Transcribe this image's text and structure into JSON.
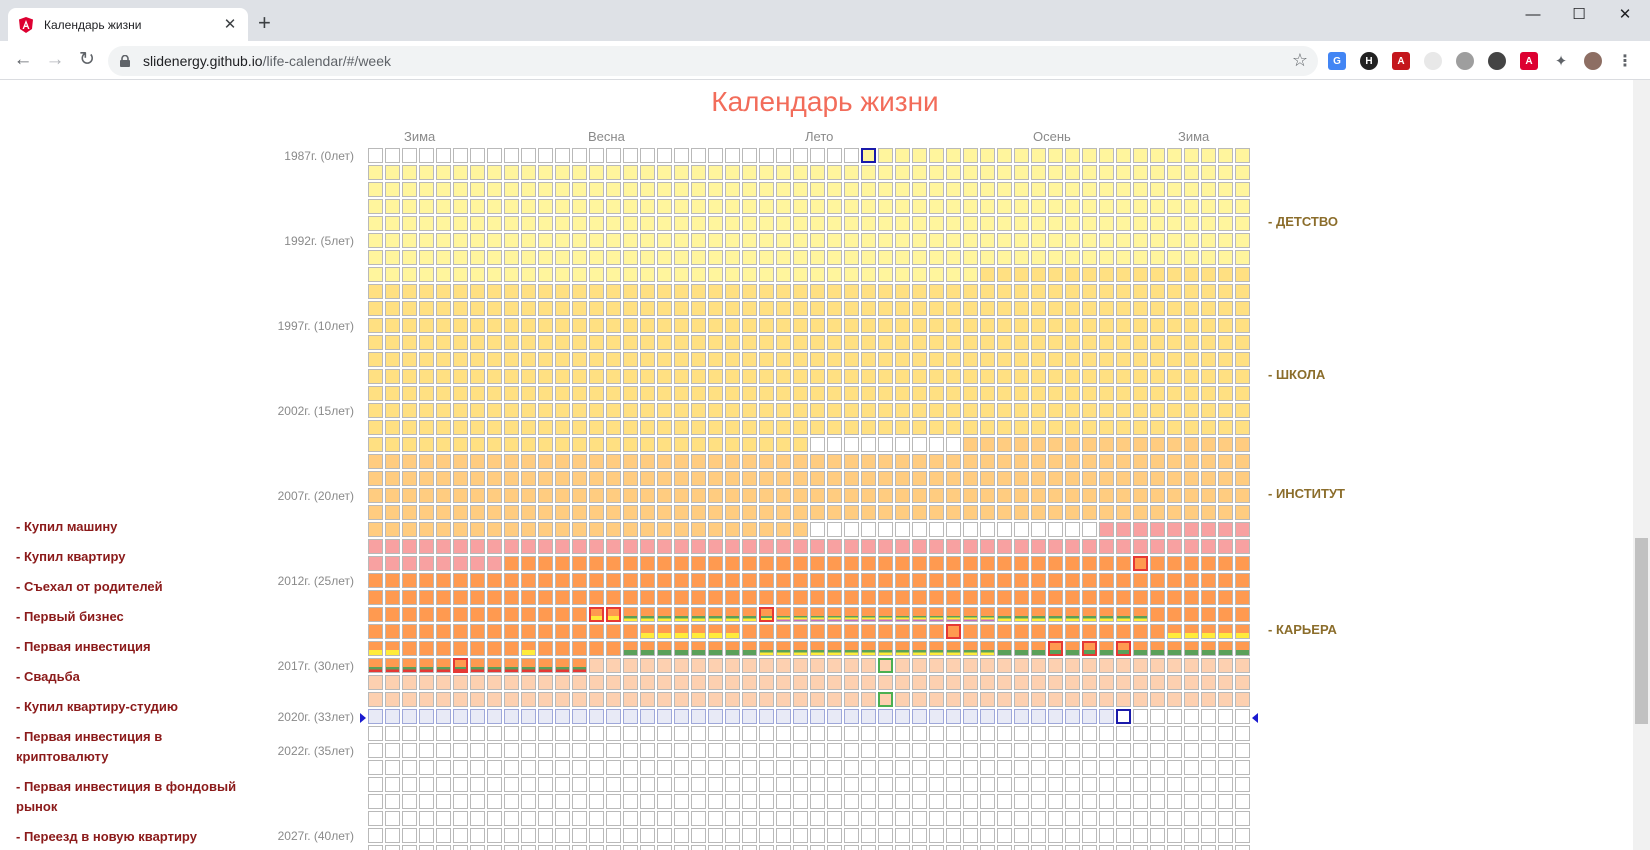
{
  "browser": {
    "tab_title": "Календарь жизни",
    "url_host": "slidenergy.github.io",
    "url_path": "/life-calendar/#/week"
  },
  "page": {
    "title": "Календарь жизни",
    "seasons": [
      "Зима",
      "Весна",
      "Лето",
      "Осень",
      "Зима"
    ],
    "year_labels": [
      {
        "row": 0,
        "text": "1987г. (0лет)"
      },
      {
        "row": 5,
        "text": "1992г. (5лет)"
      },
      {
        "row": 10,
        "text": "1997г. (10лет)"
      },
      {
        "row": 15,
        "text": "2002г. (15лет)"
      },
      {
        "row": 20,
        "text": "2007г. (20лет)"
      },
      {
        "row": 25,
        "text": "2012г. (25лет)"
      },
      {
        "row": 30,
        "text": "2017г. (30лет)"
      },
      {
        "row": 33,
        "text": "2020г. (33лет)"
      },
      {
        "row": 35,
        "text": "2022г. (35лет)"
      },
      {
        "row": 40,
        "text": "2027г. (40лет)"
      }
    ],
    "phases": [
      "- ДЕТСТВО",
      "- ШКОЛА",
      "- ИНСТИТУТ",
      "- КАРЬЕРА"
    ],
    "events": [
      "- Купил машину",
      "- Купил квартиру",
      "- Съехал от родителей",
      "- Первый бизнес",
      "- Первая инвестиция",
      "- Свадьба",
      "- Купил квартиру-студию",
      "- Первая инвестиция в криптовалюту",
      "- Первая инвестиция в фондовый рынок",
      "- Переезд в новую квартиру"
    ]
  },
  "calendar": {
    "weeks_per_row": 52,
    "birth_week": 29,
    "current_row": 33,
    "current_week": 44,
    "colors": {
      "empty": "#ffffff",
      "childhood": "#fff59d",
      "school": "#ffe082",
      "institute": "#ffcc80",
      "career_pink": "#f8a1a1",
      "career_orange": "#ff9a50",
      "career_light": "#fdd0b0",
      "current_year": "#e8eaf6",
      "event_red": "#e53935",
      "event_green": "#4caf50",
      "event_blue": "#1a1aaa",
      "stripe_yellow": "#ffeb3b",
      "stripe_green": "#5aa05a",
      "stripe_purple": "#c070c0"
    }
  }
}
